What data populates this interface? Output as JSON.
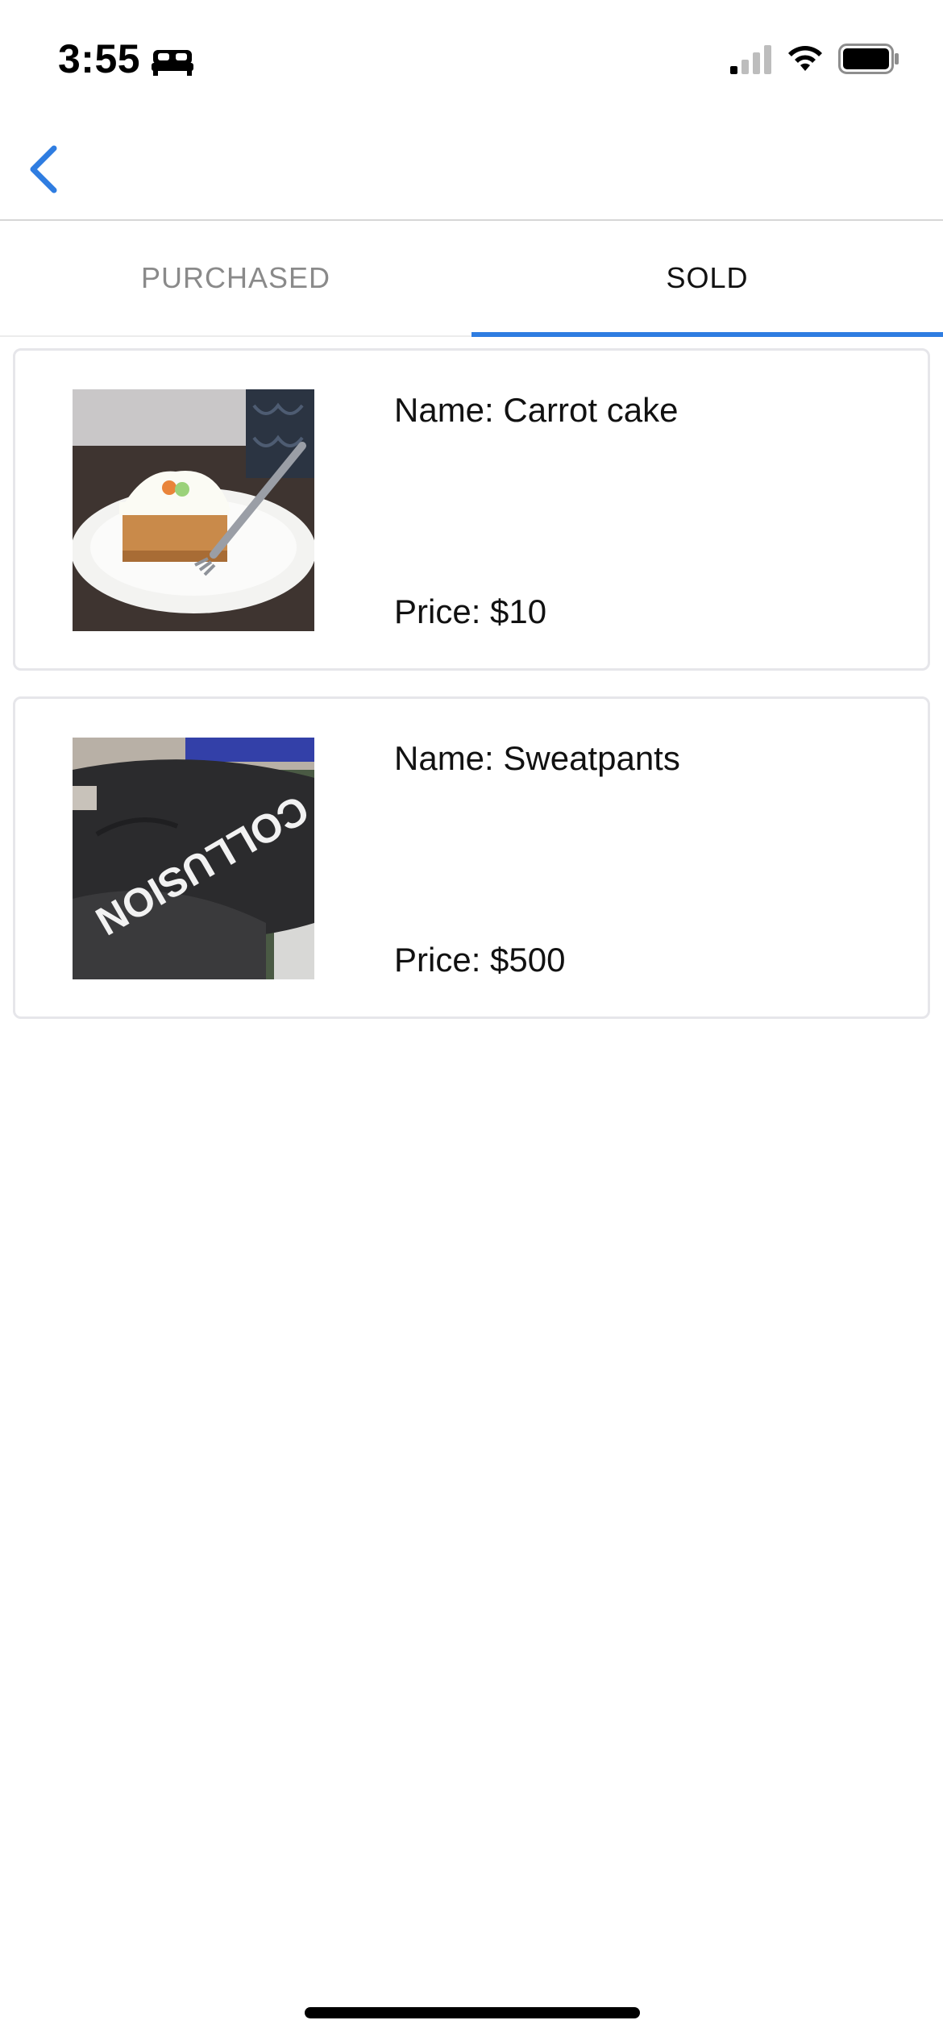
{
  "status_bar": {
    "time": "3:55",
    "focus_icon": "bed-icon",
    "signal_icon": "cellular-signal-icon",
    "wifi_icon": "wifi-icon",
    "battery_icon": "battery-icon"
  },
  "nav": {
    "back_icon": "chevron-left-icon",
    "accent_color": "#2f7de1"
  },
  "tabs": [
    {
      "label": "PURCHASED",
      "active": false
    },
    {
      "label": "SOLD",
      "active": true
    }
  ],
  "items": [
    {
      "name": "Name: Carrot cake",
      "price": "Price: $10",
      "image": "carrot-cake-photo"
    },
    {
      "name": "Name: Sweatpants",
      "price": "Price: $500",
      "image": "sweatpants-photo"
    }
  ]
}
